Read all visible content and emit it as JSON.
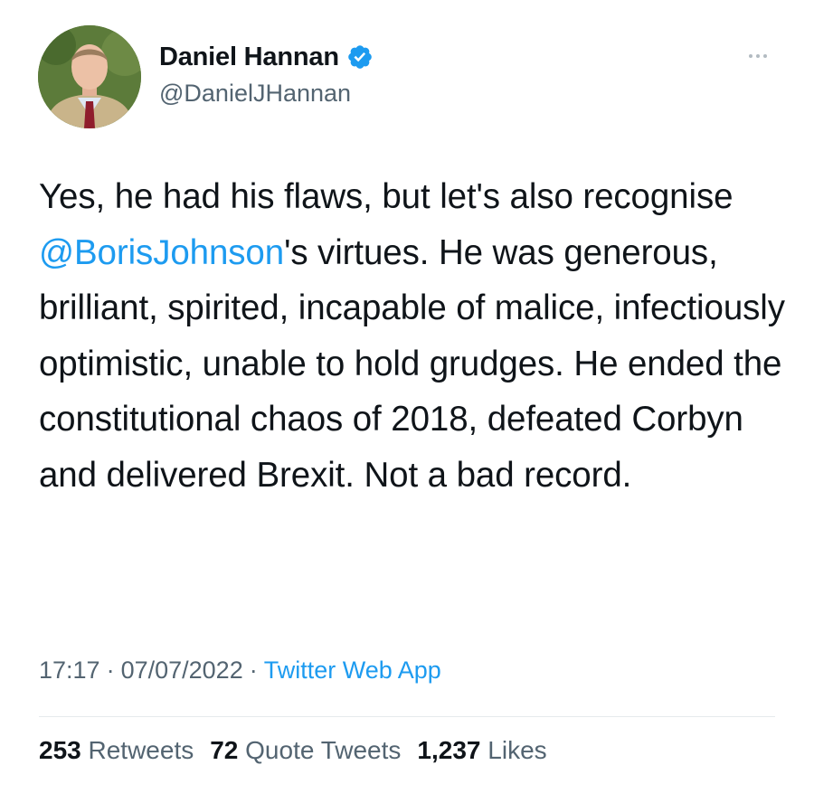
{
  "author": {
    "display_name": "Daniel Hannan",
    "handle": "@DanielJHannan",
    "verified": true
  },
  "tweet": {
    "text_segments": [
      "Yes, he had his flaws, but let's also recognise ",
      "@BorisJohnson",
      "'s virtues. He was generous, brilliant, spirited, incapable of malice, infectiously optimistic, unable to hold grudges. He ended the constitutional chaos of 2018, defeated Corbyn and delivered Brexit. Not a bad record."
    ],
    "time": "17:17",
    "separator": "·",
    "date": "07/07/2022",
    "source": "Twitter Web App"
  },
  "stats": {
    "retweets_count": "253",
    "retweets_label": "Retweets",
    "quotes_count": "72",
    "quotes_label": "Quote Tweets",
    "likes_count": "1,237",
    "likes_label": "Likes"
  },
  "icons": {
    "verified": "verified-badge-icon",
    "more": "more-options-icon"
  },
  "colors": {
    "link": "#1d9bf0",
    "secondary_text": "#536471",
    "primary_text": "#0f1419",
    "verified_badge": "#1d9bf0"
  }
}
